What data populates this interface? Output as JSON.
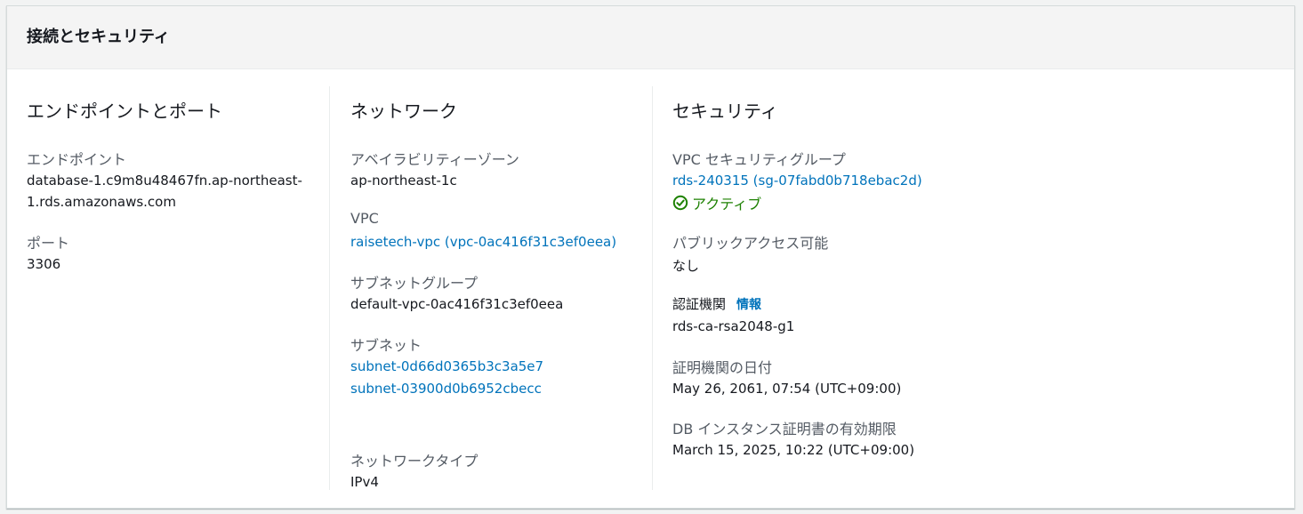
{
  "panel": {
    "title": "接続とセキュリティ"
  },
  "endpoint_section": {
    "heading": "エンドポイントとポート",
    "endpoint_label": "エンドポイント",
    "endpoint_line1": "database-1.c9m8u48467fn.ap-northeast-",
    "endpoint_line2": "1.rds.amazonaws.com",
    "port_label": "ポート",
    "port_value": "3306"
  },
  "network_section": {
    "heading": "ネットワーク",
    "az_label": "アベイラビリティーゾーン",
    "az_value": "ap-northeast-1c",
    "vpc_label": "VPC",
    "vpc_link": "raisetech-vpc (vpc-0ac416f31c3ef0eea)",
    "subnet_group_label": "サブネットグループ",
    "subnet_group_value": "default-vpc-0ac416f31c3ef0eea",
    "subnets_label": "サブネット",
    "subnets": [
      "subnet-0d66d0365b3c3a5e7",
      "subnet-03900d0b6952cbecc"
    ],
    "network_type_label": "ネットワークタイプ",
    "network_type_value": "IPv4"
  },
  "security_section": {
    "heading": "セキュリティ",
    "sg_label": "VPC セキュリティグループ",
    "sg_link": "rds-240315 (sg-07fabd0b718ebac2d)",
    "sg_status": "アクティブ",
    "sg_status_color": "#1d8102",
    "public_label": "パブリックアクセス可能",
    "public_value": "なし",
    "ca_label": "認証機関",
    "ca_info": "情報",
    "ca_value": "rds-ca-rsa2048-g1",
    "ca_date_label": "証明機関の日付",
    "ca_date_value": "May 26, 2061, 07:54 (UTC+09:00)",
    "cert_expiry_label": "DB インスタンス証明書の有効期限",
    "cert_expiry_value": "March 15, 2025, 10:22 (UTC+09:00)"
  },
  "colors": {
    "link": "#0073bb",
    "success": "#1d8102",
    "label": "#545b64"
  }
}
